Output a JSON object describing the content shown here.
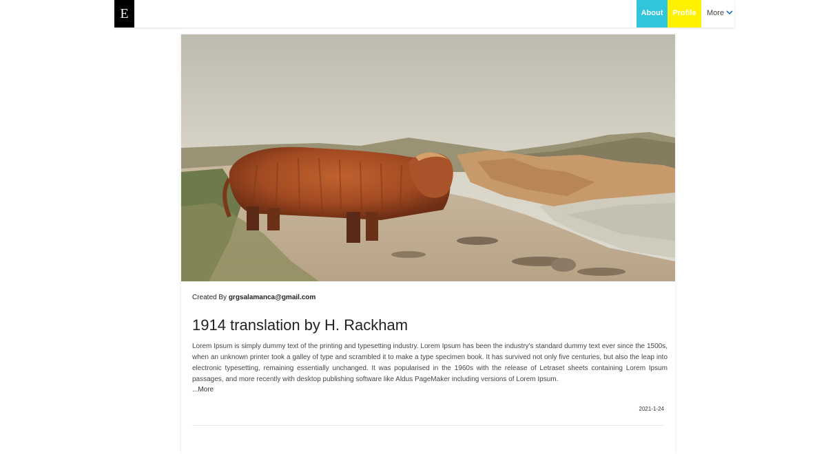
{
  "brand": {
    "logo_letter": "E"
  },
  "nav": {
    "about_label": "About",
    "profile_label": "Profile",
    "more_label": "More",
    "about_color": "#2fc6dc",
    "profile_color": "#fff200"
  },
  "post": {
    "image_alt": "highland-cow-on-rocky-shore",
    "created_by_prefix": "Created By",
    "author": "grgsalamanca@gmail.com",
    "title": "1914 translation by H. Rackham",
    "body": "Lorem Ipsum is simply dummy text of the printing and typesetting industry. Lorem Ipsum has been the industry's standard dummy text ever since the 1500s, when an unknown printer took a galley of type and scrambled it to make a type specimen book. It has survived not only five centuries, but also the leap into electronic typesetting, remaining essentially unchanged. It was popularised in the 1960s with the release of Letraset sheets containing Lorem Ipsum passages, and more recently with desktop publishing software like Aldus PageMaker including versions of Lorem Ipsum.",
    "more_label": "...More",
    "date": "2021-1-24"
  }
}
